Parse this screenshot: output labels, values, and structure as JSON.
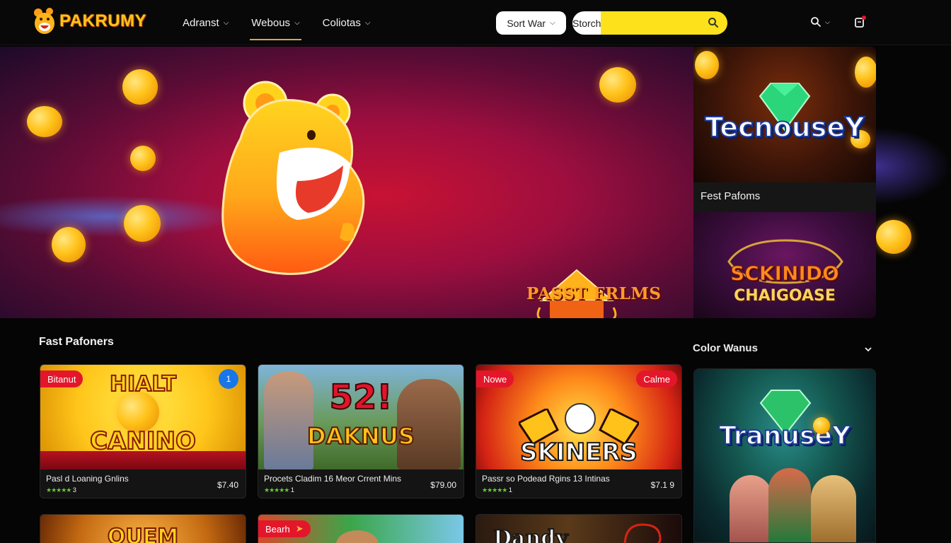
{
  "brand": {
    "name": "PAKRUMY"
  },
  "nav": {
    "items": [
      {
        "label": "Adranst"
      },
      {
        "label": "Webous"
      },
      {
        "label": "Coliotas"
      }
    ],
    "active_index": 1
  },
  "sort": {
    "label": "Sort War"
  },
  "search": {
    "label": "Storch",
    "placeholder": ""
  },
  "hero": {
    "caption": "PASST FRLMS"
  },
  "promo": {
    "top": {
      "game_logo": "TecnouseY",
      "label": "Fest Pafoms"
    },
    "bottom": {
      "game_logo_line1": "SCKINIDO",
      "game_logo_line2": "CHAIGOASE"
    }
  },
  "sections": {
    "main_title": "Fast Pafoners",
    "sidebar_title": "Color Wanus"
  },
  "cards": [
    {
      "tag": "Bitanut",
      "badge": "1",
      "art_line1": "HIALT",
      "art_line2": "CANINO",
      "title": "Pasl d Loaning Gnlins",
      "stars": "★★★★★",
      "rating": "3",
      "price": "$7.40"
    },
    {
      "tag": "",
      "badge": "",
      "art_line1": "52!",
      "art_line2": "DAKNUS",
      "title": "Procets Cladim 16 Meor Crrent Mins",
      "stars": "★★★★★",
      "rating": "1",
      "price": "$79.00"
    },
    {
      "tag": "Nowe",
      "tag_right": "Calme",
      "art_line1": "",
      "art_line2": "SKINERS",
      "title": "Passr so Podead Rgins 13 Intinas",
      "stars": "★★★★★",
      "rating": "1",
      "price": "$7.1 9"
    }
  ],
  "row2": [
    {
      "art_text": "QUEM",
      "tag": ""
    },
    {
      "art_text": "",
      "tag": "Bearh"
    },
    {
      "art_text": "Dandy",
      "tag": ""
    }
  ],
  "sidebar_card": {
    "game_logo": "TranuseY"
  },
  "colors": {
    "accent_yellow": "#fde21b",
    "tag_red": "#e4162a",
    "badge_blue": "#1876e8",
    "star_green": "#6ac43a"
  },
  "icons": [
    "bear-logo-icon",
    "chevron-down-icon",
    "search-icon",
    "notification-icon"
  ]
}
